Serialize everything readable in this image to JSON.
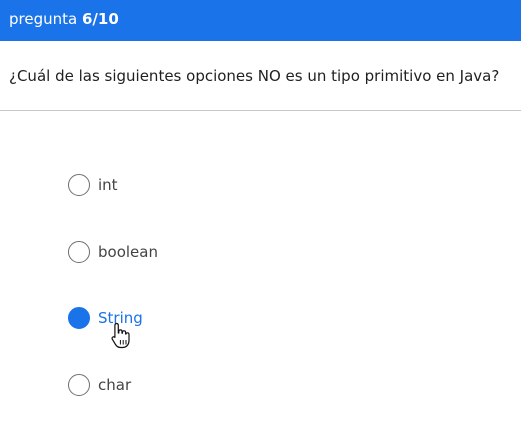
{
  "header": {
    "prefix": "pregunta ",
    "counter": "6/10"
  },
  "question": {
    "text": "¿Cuál de las siguientes opciones NO es un tipo primitivo en Java?"
  },
  "options": [
    {
      "label": "int",
      "selected": false
    },
    {
      "label": "boolean",
      "selected": false
    },
    {
      "label": "String",
      "selected": true
    },
    {
      "label": "char",
      "selected": false
    }
  ],
  "colors": {
    "accent": "#1a73e8",
    "header_text": "#ffffff",
    "radio_border": "#6e6e6e",
    "option_text": "#444444"
  },
  "cursor": {
    "icon": "hand-pointer-icon"
  }
}
